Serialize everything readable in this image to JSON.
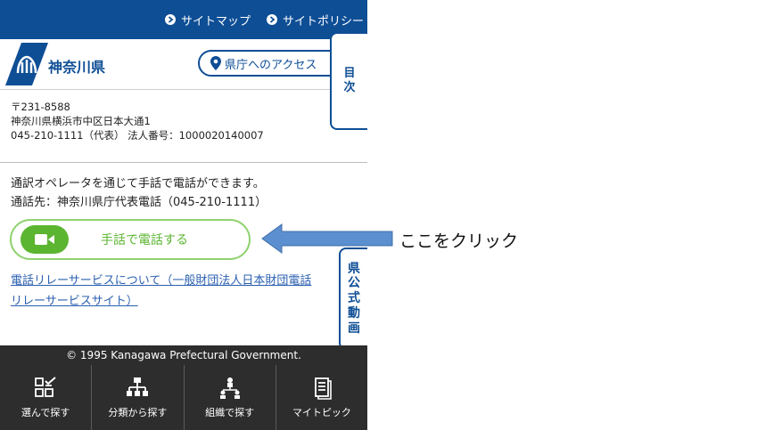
{
  "topbar": {
    "links": [
      {
        "label": "サイトマップ"
      },
      {
        "label": "サイトポリシー"
      }
    ]
  },
  "header": {
    "logo_text": "神奈川県",
    "access_button": "県庁へのアクセス"
  },
  "side_tabs": {
    "toc": [
      "目",
      "次"
    ],
    "video": [
      "県",
      "公",
      "式",
      "動",
      "画"
    ]
  },
  "address": {
    "postal": "〒231-8588",
    "street": "神奈川県横浜市中区日本大通1",
    "phone_corp": "045-210-1111（代表） 法人番号：1000020140007"
  },
  "main": {
    "desc_line1": "通訳オペレータを通じて手話で電話ができます。",
    "desc_line2": "通話先：神奈川県庁代表電話（045-210-1111）",
    "video_call_button": "手話で電話する",
    "relay_link_line1": "電話リレーサービスについて（一般財団法人日本財団電話",
    "relay_link_line2": "リレーサービスサイト）"
  },
  "footer": {
    "copyright": "© 1995 Kanagawa Prefectural Government."
  },
  "bottom_nav": [
    {
      "label": "選んで探す",
      "icon": "checklist-icon"
    },
    {
      "label": "分類から探す",
      "icon": "hierarchy-icon"
    },
    {
      "label": "組織で探す",
      "icon": "people-tree-icon"
    },
    {
      "label": "マイトピック",
      "icon": "document-icon"
    }
  ],
  "annotation": {
    "text": "ここをクリック"
  },
  "colors": {
    "brand_blue": "#0e4e95",
    "call_green": "#5cb531",
    "call_border": "#8fd26f",
    "footer_dark": "#2d2d2d",
    "arrow_blue": "#5b8fcf"
  }
}
